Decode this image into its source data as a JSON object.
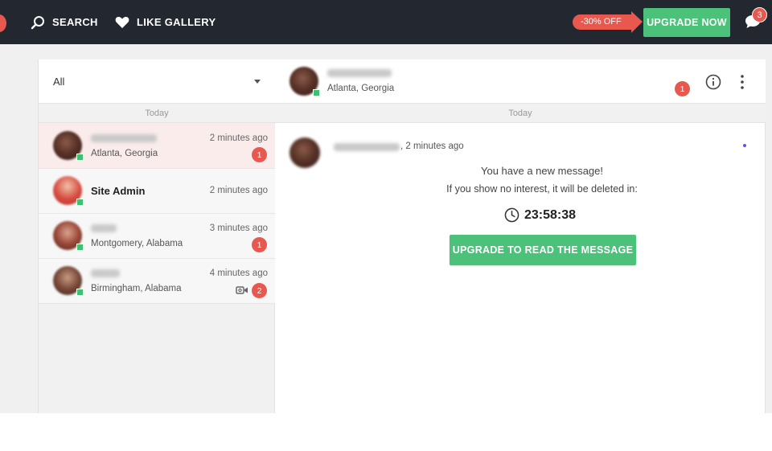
{
  "topbar": {
    "search_label": "SEARCH",
    "like_gallery_label": "LIKE GALLERY",
    "discount_label": "-30% OFF",
    "upgrade_label": "UPGRADE NOW",
    "chat_badge_count": "3",
    "colors": {
      "bar": "#222730",
      "accent": "#e8584f",
      "green": "#4cc17a"
    }
  },
  "sidebar": {
    "filter_value": "All",
    "day_label": "Today",
    "conversations": [
      {
        "name": "",
        "location": "Atlanta, Georgia",
        "time": "2 minutes ago",
        "unread": "1",
        "active": true
      },
      {
        "name": "Site Admin",
        "location": "",
        "time": "2 minutes ago",
        "unread": "",
        "active": false
      },
      {
        "name": "",
        "location": "Montgomery, Alabama",
        "time": "3 minutes ago",
        "unread": "1",
        "active": false
      },
      {
        "name": "",
        "location": "Birmingham, Alabama",
        "time": "4 minutes ago",
        "unread": "2",
        "has_video": true,
        "active": false
      }
    ]
  },
  "chat": {
    "header_location": "Atlanta, Georgia",
    "header_badge": "1",
    "day_label": "Today",
    "message_time": ", 2 minutes ago",
    "line1": "You have a new message!",
    "line2": "If you show no interest, it will be deleted in:",
    "countdown": "23:58:38",
    "read_button_label": "UPGRADE TO READ THE MESSAGE"
  }
}
